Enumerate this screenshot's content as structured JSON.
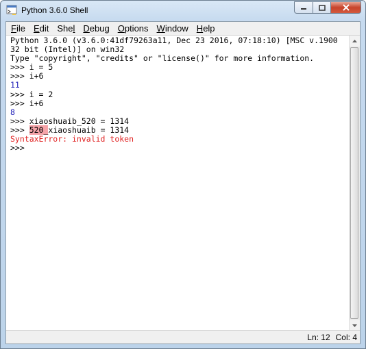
{
  "window": {
    "title": "Python 3.6.0 Shell"
  },
  "menu": [
    {
      "key": "F",
      "rest": "ile"
    },
    {
      "key": "E",
      "rest": "dit"
    },
    {
      "key": "She",
      "rest": "l",
      "pre": "She",
      "k2": "l"
    },
    {
      "key": "D",
      "rest": "ebug"
    },
    {
      "key": "O",
      "rest": "ptions"
    },
    {
      "key": "W",
      "rest": "indow"
    },
    {
      "key": "H",
      "rest": "elp"
    }
  ],
  "shell": {
    "header1": "Python 3.6.0 (v3.6.0:41df79263a11, Dec 23 2016, 07:18:10) [MSC v.1900",
    "header2": "32 bit (Intel)] on win32",
    "header3": "Type \"copyright\", \"credits\" or \"license()\" for more information.",
    "prompt": ">>> ",
    "cmd1": "i = 5",
    "cmd2": "i+6",
    "out1": "11",
    "cmd3": "i = 2",
    "cmd4": "i+6",
    "out2": "8",
    "cmd5": "xiaoshuaib_520 = 1314",
    "cmd6_hl": "520_",
    "cmd6_rest": "xiaoshuaib = 1314",
    "error": "SyntaxError: invalid token"
  },
  "status": {
    "line": "Ln: 12",
    "col": "Col: 4"
  },
  "colors": {
    "output": "#1f1fb8",
    "error": "#e02020",
    "highlight": "#f5a3a8"
  }
}
